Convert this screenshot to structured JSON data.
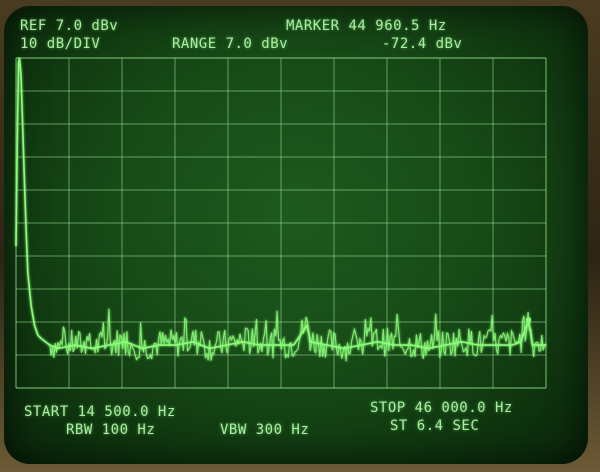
{
  "readout": {
    "ref": "REF 7.0 dBv",
    "scale": "10 dB/DIV",
    "range": "RANGE 7.0 dBv",
    "marker_freq": "MARKER 44 960.5 Hz",
    "marker_level": "-72.4 dBv",
    "start": "START 14 500.0 Hz",
    "stop": "STOP 46 000.0 Hz",
    "rbw": "RBW 100 Hz",
    "vbw": "VBW 300 Hz",
    "sweep_time": "ST 6.4 SEC"
  },
  "colors": {
    "trace": "#8cff7a",
    "grid": "#9ee89a",
    "text": "#a8f0a0"
  },
  "chart_data": {
    "type": "line",
    "x_unit": "Hz",
    "y_unit": "dBv",
    "xlim": [
      14500,
      46000
    ],
    "ylim": [
      -93,
      7
    ],
    "grid": true,
    "x_divisions": 10,
    "y_divisions": 10,
    "series": [
      {
        "x": [
          14500,
          14550,
          14600,
          14650,
          14700,
          14800,
          14900,
          15000,
          15100,
          15200,
          15400,
          15600,
          15800,
          16000,
          16500,
          17000,
          18000,
          19000,
          20000,
          21000,
          22000,
          23000,
          24000,
          25000,
          26000,
          27000,
          28000,
          29000,
          30000,
          31000,
          31800,
          32000,
          33000,
          34000,
          35000,
          36000,
          37000,
          38000,
          39000,
          40000,
          41000,
          42000,
          43000,
          44000,
          44500,
          44960,
          45200,
          45600,
          46000
        ],
        "y": [
          -50,
          -30,
          -10,
          5.5,
          7,
          2,
          -14,
          -30,
          -45,
          -58,
          -68,
          -74,
          -77,
          -78,
          -80,
          -81,
          -80,
          -81,
          -80,
          -79,
          -81,
          -80,
          -80,
          -79,
          -81,
          -80,
          -79,
          -80,
          -80,
          -80,
          -74,
          -79,
          -80,
          -81,
          -80,
          -79,
          -80,
          -80,
          -81,
          -80,
          -79,
          -80,
          -80,
          -80,
          -79,
          -72.4,
          -80,
          -80,
          -80
        ]
      }
    ],
    "marker": {
      "x": 44960.5,
      "y": -72.4
    }
  }
}
